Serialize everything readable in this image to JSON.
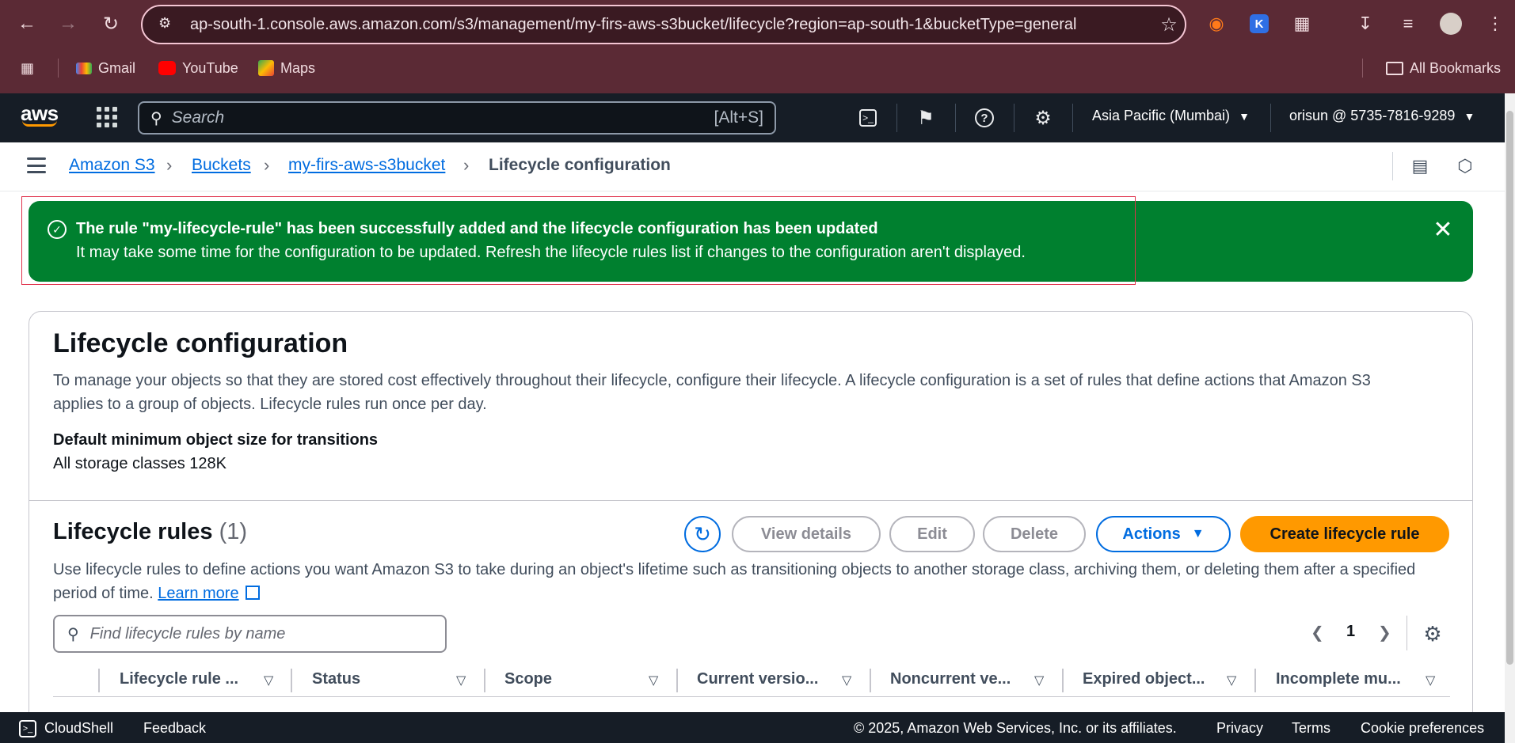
{
  "browser": {
    "url": "ap-south-1.console.aws.amazon.com/s3/management/my-firs-aws-s3bucket/lifecycle?region=ap-south-1&bucketType=general",
    "bookmarks": [
      {
        "label": "Gmail",
        "icon": "gmail-icon"
      },
      {
        "label": "YouTube",
        "icon": "youtube-icon"
      },
      {
        "label": "Maps",
        "icon": "maps-icon"
      }
    ],
    "all_bookmarks": "All Bookmarks"
  },
  "aws_nav": {
    "logo": "aws",
    "search_placeholder": "Search",
    "search_shortcut": "[Alt+S]",
    "region": "Asia Pacific (Mumbai)",
    "account": "orisun @ 5735-7816-9289"
  },
  "breadcrumb": {
    "items": [
      "Amazon S3",
      "Buckets",
      "my-firs-aws-s3bucket"
    ],
    "current": "Lifecycle configuration"
  },
  "flash": {
    "title": "The rule \"my-lifecycle-rule\" has been successfully added and the lifecycle configuration has been updated",
    "body": "It may take some time for the configuration to be updated. Refresh the lifecycle rules list if changes to the configuration aren't displayed."
  },
  "page": {
    "title": "Lifecycle configuration",
    "description": "To manage your objects so that they are stored cost effectively throughout their lifecycle, configure their lifecycle. A lifecycle configuration is a set of rules that define actions that Amazon S3 applies to a group of objects. Lifecycle rules run once per day.",
    "kv_label": "Default minimum object size for transitions",
    "kv_value": "All storage classes 128K"
  },
  "rules": {
    "title": "Lifecycle rules",
    "count": "(1)",
    "buttons": {
      "view_details": "View details",
      "edit": "Edit",
      "delete": "Delete",
      "actions": "Actions",
      "create": "Create lifecycle rule"
    },
    "description": "Use lifecycle rules to define actions you want Amazon S3 to take during an object's lifetime such as transitioning objects to another storage class, archiving them, or deleting them after a specified period of time.",
    "learn_more": "Learn more",
    "filter_placeholder": "Find lifecycle rules by name",
    "page_number": "1",
    "columns": [
      "Lifecycle rule ...",
      "Status",
      "Scope",
      "Current versio...",
      "Noncurrent ve...",
      "Expired object...",
      "Incomplete mu..."
    ]
  },
  "footer": {
    "cloudshell": "CloudShell",
    "feedback": "Feedback",
    "copyright": "© 2025, Amazon Web Services, Inc. or its affiliates.",
    "privacy": "Privacy",
    "terms": "Terms",
    "cookies": "Cookie preferences"
  },
  "colors": {
    "success": "#00802f",
    "primary_button": "#ff9900",
    "link": "#006ce0",
    "nav_bg": "#161d26",
    "browser_bg": "#5b2a35"
  }
}
